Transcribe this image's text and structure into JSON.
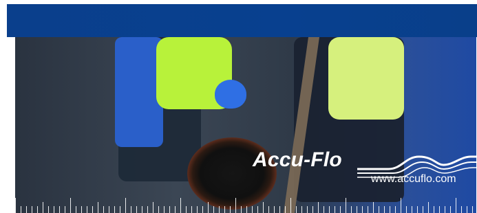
{
  "brand": {
    "logo_text": "Accu-Flo",
    "url": "www.accuflo.com"
  },
  "colors": {
    "brand_blue": "#0a3f8c",
    "vest_yellow": "#b8f23a",
    "ruler_white": "#ffffff"
  },
  "icons": {
    "logo_wave": "accu-flo-wave-logo-icon"
  }
}
